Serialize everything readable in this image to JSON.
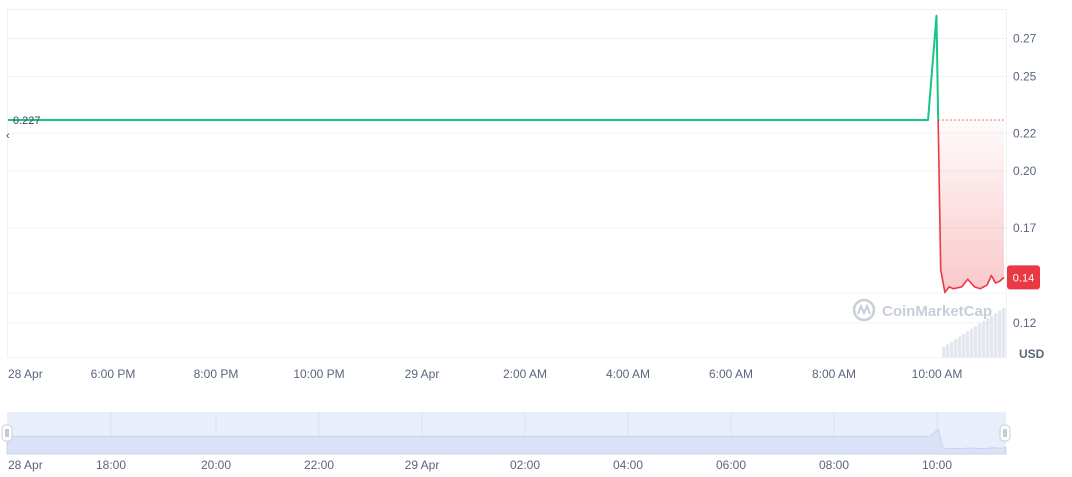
{
  "chart_data": {
    "type": "line",
    "currency": "USD",
    "watermark": "CoinMarketCap",
    "open_price_label": "0.227",
    "current_price_label": "0.14",
    "x_ticks": [
      "28 Apr",
      "6:00 PM",
      "8:00 PM",
      "10:00 PM",
      "29 Apr",
      "2:00 AM",
      "4:00 AM",
      "6:00 AM",
      "8:00 AM",
      "10:00 AM"
    ],
    "navigator_ticks": [
      "28 Apr",
      "18:00",
      "20:00",
      "22:00",
      "29 Apr",
      "02:00",
      "04:00",
      "06:00",
      "08:00",
      "10:00"
    ],
    "y_ticks": [
      "0.27",
      "0.25",
      "0.22",
      "0.20",
      "0.17",
      "0.14",
      "0.12"
    ],
    "y_range": [
      0.102,
      0.285
    ],
    "reference_price": 0.227,
    "grid": true,
    "series": [
      {
        "values": [
          {
            "x": "2024-04-28 15:40",
            "y": 0.227
          },
          {
            "x": "2024-04-29 09:50",
            "y": 0.227
          },
          {
            "x": "2024-04-29 10:00",
            "y": 0.282
          },
          {
            "x": "2024-04-29 10:02",
            "y": 0.227
          },
          {
            "x": "2024-04-29 10:05",
            "y": 0.148
          },
          {
            "x": "2024-04-29 10:10",
            "y": 0.136
          },
          {
            "x": "2024-04-29 10:15",
            "y": 0.139
          },
          {
            "x": "2024-04-29 10:20",
            "y": 0.138
          },
          {
            "x": "2024-04-29 10:30",
            "y": 0.139
          },
          {
            "x": "2024-04-29 10:37",
            "y": 0.143
          },
          {
            "x": "2024-04-29 10:45",
            "y": 0.139
          },
          {
            "x": "2024-04-29 10:52",
            "y": 0.138
          },
          {
            "x": "2024-04-29 11:00",
            "y": 0.14
          },
          {
            "x": "2024-04-29 11:05",
            "y": 0.145
          },
          {
            "x": "2024-04-29 11:10",
            "y": 0.141
          },
          {
            "x": "2024-04-29 11:15",
            "y": 0.142
          },
          {
            "x": "2024-04-29 11:20",
            "y": 0.144
          }
        ]
      }
    ],
    "colors": {
      "up": "#16c784",
      "down": "#ea3943",
      "grid": "#eff2f5",
      "axis_text": "#58667e",
      "navigator_fill": "#dbe2f7",
      "volume": "#e3e7ef"
    }
  }
}
